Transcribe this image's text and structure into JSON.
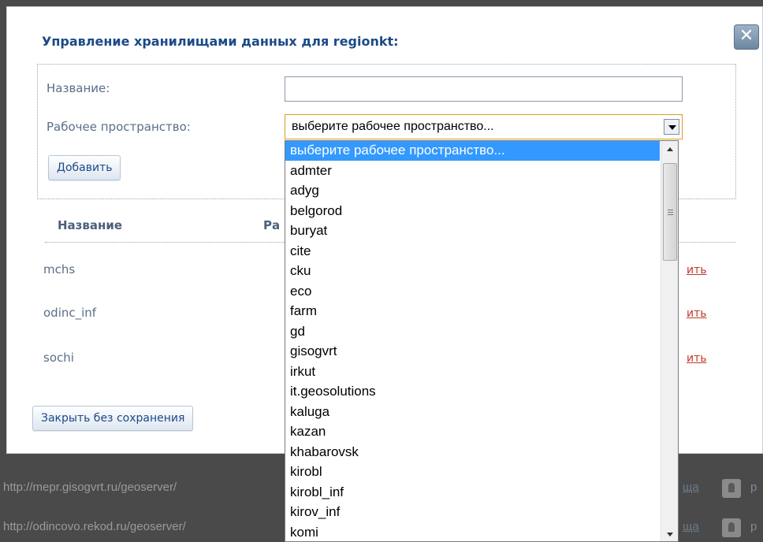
{
  "dialog": {
    "title": "Управление хранилищами данных для regionkt:",
    "close_label": "✕"
  },
  "form": {
    "name_label": "Название:",
    "name_value": "",
    "workspace_label": "Рабочее пространство:",
    "workspace_selected": "выберите рабочее пространство...",
    "add_button": "Добавить"
  },
  "table": {
    "headers": [
      "Название",
      "Ра"
    ],
    "rows": [
      {
        "name": "mchs",
        "action": "ить"
      },
      {
        "name": "odinc_inf",
        "action": "ить"
      },
      {
        "name": "sochi",
        "action": "ить"
      }
    ]
  },
  "close_without_saving": "Закрыть без сохранения",
  "dropdown": {
    "options": [
      "выберите рабочее пространство...",
      "admter",
      "adyg",
      "belgorod",
      "buryat",
      "cite",
      "cku",
      "eco",
      "farm",
      "gd",
      "gisogvrt",
      "irkut",
      "it.geosolutions",
      "kaluga",
      "kazan",
      "khabarovsk",
      "kirobl",
      "kirobl_inf",
      "kirov_inf",
      "komi"
    ],
    "selected_index": 0
  },
  "background": {
    "rows": [
      {
        "url": "http://mepr.gisogvrt.ru/geoserver/",
        "link": "ща",
        "edge": "р"
      },
      {
        "url": "http://odincovo.rekod.ru/geoserver/",
        "link": "ща",
        "edge": "р"
      }
    ]
  }
}
